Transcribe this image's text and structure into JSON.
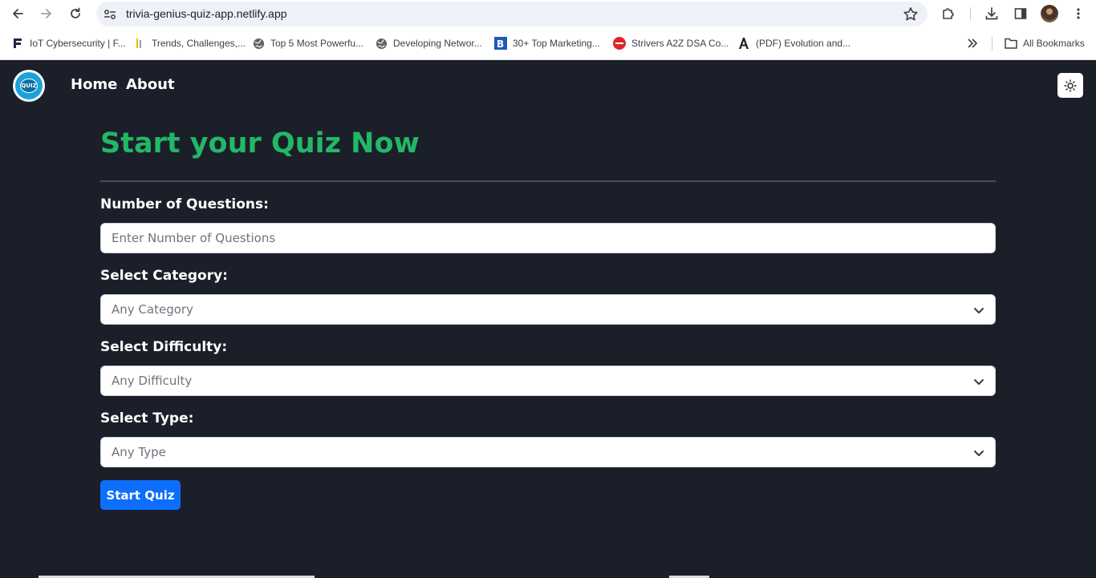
{
  "browser": {
    "url": "trivia-genius-quiz-app.netlify.app",
    "bookmarks": [
      {
        "label": "IoT Cybersecurity | F...",
        "icon": "f-logo-icon"
      },
      {
        "label": "Trends, Challenges,...",
        "icon": "bars-icon"
      },
      {
        "label": "Top 5 Most Powerfu...",
        "icon": "globe-icon"
      },
      {
        "label": "Developing Networ...",
        "icon": "globe-icon"
      },
      {
        "label": "30+ Top Marketing...",
        "icon": "b-logo-icon"
      },
      {
        "label": "Strivers A2Z DSA Co...",
        "icon": "tuf-logo-icon"
      },
      {
        "label": "(PDF) Evolution and...",
        "icon": "a-logo-icon"
      }
    ],
    "all_bookmarks": "All Bookmarks"
  },
  "nav": {
    "logo_text": "QUIZ",
    "links": [
      "Home",
      "About"
    ]
  },
  "main": {
    "title": "Start your Quiz Now",
    "questions_label": "Number of Questions:",
    "questions_placeholder": "Enter Number of Questions",
    "category_label": "Select Category:",
    "category_value": "Any Category",
    "difficulty_label": "Select Difficulty:",
    "difficulty_value": "Any Difficulty",
    "type_label": "Select Type:",
    "type_value": "Any Type",
    "start_button": "Start Quiz"
  },
  "colors": {
    "background": "#1b1f2a",
    "title": "#22b865",
    "button": "#0d6efd"
  }
}
